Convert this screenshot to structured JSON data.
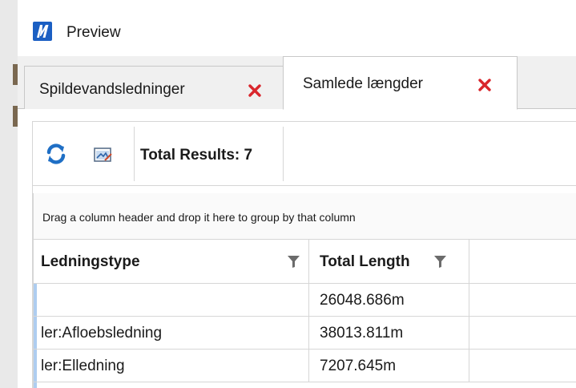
{
  "window": {
    "title": "Preview",
    "app_icon": "microstation-logo-icon"
  },
  "tabs": [
    {
      "label": "Spildevandsledninger",
      "active": false,
      "close_icon": "close-icon"
    },
    {
      "label": "Samlede længder",
      "active": true,
      "close_icon": "close-icon"
    }
  ],
  "toolbar": {
    "refresh_icon": "refresh-icon",
    "export_icon": "export-icon",
    "total_results": "Total Results: 7"
  },
  "grid": {
    "group_hint": "Drag a column header and drop it here to group by that column",
    "columns": [
      {
        "label": "Ledningstype",
        "filter_icon": "filter-icon"
      },
      {
        "label": "Total Length",
        "filter_icon": "filter-icon"
      }
    ],
    "rows": [
      {
        "ledningstype": "",
        "total_length": "26048.686m"
      },
      {
        "ledningstype": "ler:Afloebsledning",
        "total_length": "38013.811m"
      },
      {
        "ledningstype": "ler:Elledning",
        "total_length": "7207.645m"
      }
    ]
  },
  "colors": {
    "accent": "#1b5fc3",
    "close_red": "#d9262c",
    "refresh_blue": "#1f6fc5",
    "row_indicator": "#aecdf0",
    "border": "#d6d6d6"
  }
}
